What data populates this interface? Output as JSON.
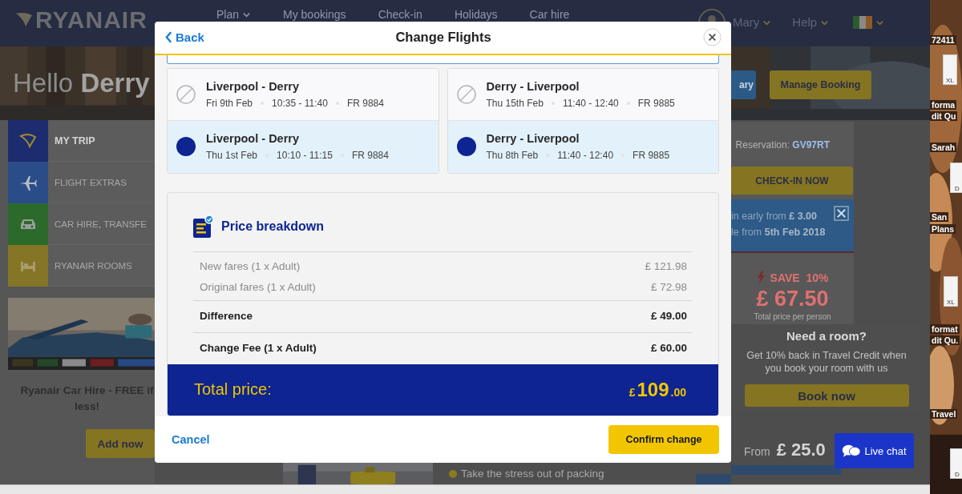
{
  "nav": {
    "logo": "RYANAIR",
    "items": [
      {
        "label": "Plan",
        "dropdown": true
      },
      {
        "label": "My bookings",
        "dropdown": false
      },
      {
        "label": "Check-in",
        "dropdown": false
      },
      {
        "label": "Holidays",
        "dropdown": false
      },
      {
        "label": "Car hire",
        "dropdown": false
      }
    ],
    "user": "Mary",
    "help": "Help"
  },
  "hero": {
    "greeting": "Hello **Derry**"
  },
  "sidebar": {
    "items": [
      {
        "label": "MY TRIP",
        "selected": true,
        "color": "#1d2c6e"
      },
      {
        "label": "FLIGHT EXTRAS",
        "selected": false,
        "color": "#2a4d8a"
      },
      {
        "label": "CAR HIRE, TRANSFE",
        "selected": false,
        "color": "#2c6a2c"
      },
      {
        "label": "RYANAIR ROOMS",
        "selected": false,
        "color": "#857526"
      }
    ]
  },
  "car_hire": {
    "text": "Ryanair Car Hire -  FREE if less!",
    "button": "Add now"
  },
  "packing": {
    "text": "Take the stress out of packing"
  },
  "booking": {
    "buttons": [
      "ary",
      "Manage Booking"
    ],
    "reservation": "Reservation: **GV97RT**",
    "checkin": "CHECK-IN NOW",
    "tooltip": [
      "in early from **£ 3.00**",
      "le from **5th Feb 2018**"
    ],
    "save": "SAVE  10%",
    "price": "£ 67.50",
    "price_note": "Total price per person"
  },
  "room": {
    "title": "Need a room?",
    "text": "Get 10% back in Travel Credit when you book your room with us",
    "button": "Book now"
  },
  "offer": {
    "from": "From",
    "price": "£ 25.0"
  },
  "live_chat": "Live chat",
  "desktop": {
    "labels": [
      "72411",
      "forma",
      "dit Qu",
      "Sarah",
      "San",
      "Plans",
      "format",
      "dit Qu.",
      "Travel"
    ],
    "file_icons": [
      "XL",
      "D",
      "XL",
      "D"
    ]
  },
  "modal": {
    "back": "Back",
    "title": "Change Flights",
    "journeys": [
      {
        "options": [
          {
            "route": "Liverpool - Derry",
            "date": "Fri 9th Feb",
            "time": "10:35 - 11:40",
            "flight": "FR 9884",
            "selected": false
          },
          {
            "route": "Liverpool - Derry",
            "date": "Thu 1st Feb",
            "time": "10:10 - 11:15",
            "flight": "FR 9884",
            "selected": true
          }
        ]
      },
      {
        "options": [
          {
            "route": "Derry - Liverpool",
            "date": "Thu 15th Feb",
            "time": "11:40 - 12:40",
            "flight": "FR 9885",
            "selected": false
          },
          {
            "route": "Derry - Liverpool",
            "date": "Thu 8th Feb",
            "time": "11:40 - 12:40",
            "flight": "FR 9885",
            "selected": true
          }
        ]
      }
    ],
    "breakdown": {
      "title": "Price breakdown",
      "groups": [
        {
          "kind": "minor",
          "rows": [
            {
              "label": "New fares (1 x Adult)",
              "amount": "£ 121.98"
            },
            {
              "label": "Original fares (1 x Adult)",
              "amount": "£ 72.98"
            }
          ]
        },
        {
          "kind": "major",
          "rows": [
            {
              "label": "Difference",
              "amount": "£ 49.00"
            }
          ]
        },
        {
          "kind": "major",
          "rows": [
            {
              "label": "Change Fee (1 x Adult)",
              "amount": "£ 60.00"
            }
          ]
        }
      ],
      "total": {
        "label": "Total price:",
        "currency": "£",
        "whole": "109",
        "fraction": ".00"
      }
    },
    "cancel": "Cancel",
    "confirm": "Confirm change"
  }
}
